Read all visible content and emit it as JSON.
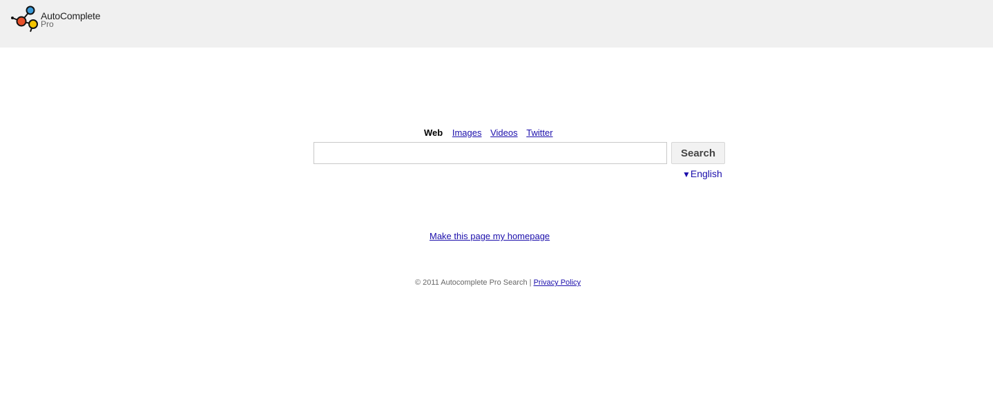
{
  "header": {
    "logo_title": "AutoComplete",
    "logo_subtitle": "Pro",
    "background": "#f0f0f0"
  },
  "tabs": [
    {
      "label": "Web",
      "active": true
    },
    {
      "label": "Images",
      "active": false
    },
    {
      "label": "Videos",
      "active": false
    },
    {
      "label": "Twitter",
      "active": false
    }
  ],
  "search": {
    "value": "",
    "placeholder": "",
    "button_label": "Search"
  },
  "language": {
    "indicator": "▼",
    "label": "English"
  },
  "homepage_link": "Make this page my homepage",
  "footer": {
    "copyright": "© 2011 Autocomplete Pro Search |",
    "privacy_label": "Privacy Policy"
  },
  "colors": {
    "link": "#1a0dab",
    "logo_red": "#e8512a",
    "logo_yellow": "#f5c400",
    "logo_blue": "#3a9ad9"
  }
}
